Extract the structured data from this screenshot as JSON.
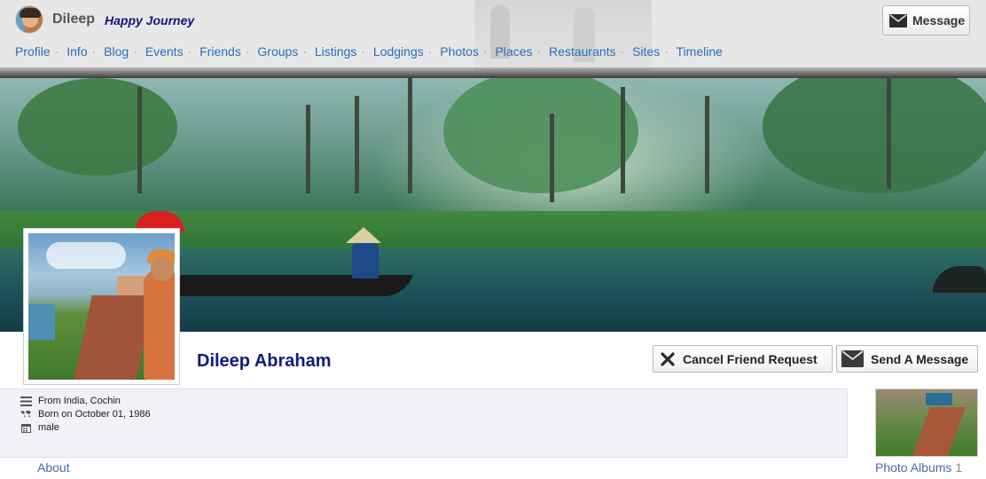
{
  "header": {
    "username": "Dileep",
    "tagline": "Happy Journey",
    "message_button": "Message"
  },
  "nav": {
    "items": [
      "Profile",
      "Info",
      "Blog",
      "Events",
      "Friends",
      "Groups",
      "Listings",
      "Lodgings",
      "Photos",
      "Places",
      "Restaurants",
      "Sites",
      "Timeline"
    ]
  },
  "profile": {
    "full_name": "Dileep Abraham",
    "cancel_friend_request": "Cancel Friend Request",
    "send_message": "Send A Message"
  },
  "info": {
    "from": "From India, Cochin",
    "born": "Born on October 01, 1986",
    "gender": "male"
  },
  "footer": {
    "about": "About",
    "photo_albums": "Photo Albums",
    "photo_albums_count": "1"
  },
  "colors": {
    "link": "#2a6ebb",
    "name": "#0f1a7a",
    "panel": "#f1f2f6"
  }
}
